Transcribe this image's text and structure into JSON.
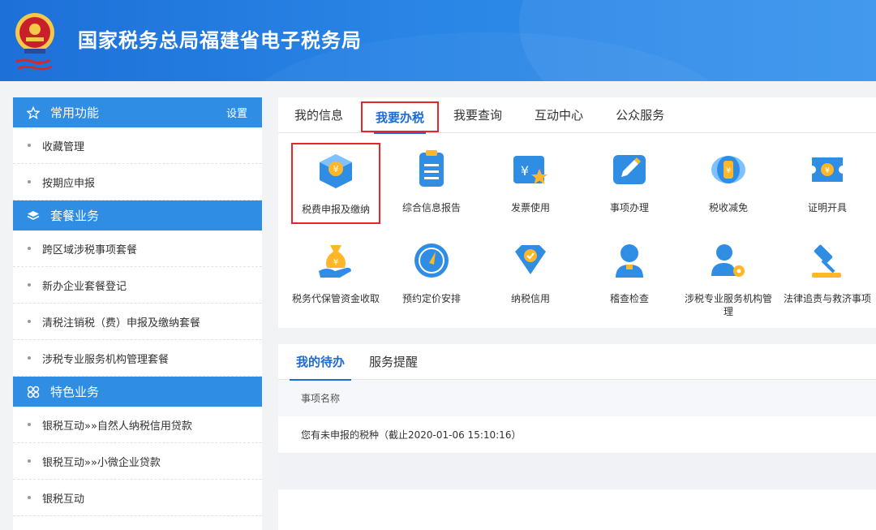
{
  "header": {
    "title": "国家税务总局福建省电子税务局"
  },
  "sidebar": {
    "common": {
      "title": "常用功能",
      "settings": "设置",
      "icon": "star-icon",
      "items": [
        "收藏管理",
        "按期应申报"
      ]
    },
    "package": {
      "title": "套餐业务",
      "icon": "layers-icon",
      "items": [
        "跨区域涉税事项套餐",
        "新办企业套餐登记",
        "清税注销税（费）申报及缴纳套餐",
        "涉税专业服务机构管理套餐"
      ]
    },
    "special": {
      "title": "特色业务",
      "icon": "grid-icon",
      "items": [
        "银税互动»»自然人纳税信用贷款",
        "银税互动»»小微企业贷款",
        "银税互动"
      ]
    }
  },
  "main": {
    "tabs": [
      "我的信息",
      "我要办税",
      "我要查询",
      "互动中心",
      "公众服务"
    ],
    "active_tab": "我要办税",
    "tiles": [
      {
        "label": "税费申报及缴纳",
        "icon": "tax-declare-icon"
      },
      {
        "label": "综合信息报告",
        "icon": "report-icon"
      },
      {
        "label": "发票使用",
        "icon": "invoice-icon"
      },
      {
        "label": "事项办理",
        "icon": "edit-icon"
      },
      {
        "label": "税收减免",
        "icon": "tax-relief-icon"
      },
      {
        "label": "证明开具",
        "icon": "certificate-icon"
      },
      {
        "label": "税务代保管资金收取",
        "icon": "money-bag-icon"
      },
      {
        "label": "预约定价安排",
        "icon": "compass-icon"
      },
      {
        "label": "纳税信用",
        "icon": "credit-icon"
      },
      {
        "label": "稽查检查",
        "icon": "inspector-icon"
      },
      {
        "label": "涉税专业服务机构管理",
        "icon": "agent-manage-icon"
      },
      {
        "label": "法律追责与救济事项",
        "icon": "gavel-icon"
      }
    ]
  },
  "todo": {
    "tabs": [
      "我的待办",
      "服务提醒"
    ],
    "column": "事项名称",
    "rows": [
      "您有未申报的税种（截止2020-01-06 15:10:16）"
    ]
  },
  "colors": {
    "primary": "#2f8de4",
    "highlight": "#e5262b",
    "active_text": "#1d6ad6"
  }
}
